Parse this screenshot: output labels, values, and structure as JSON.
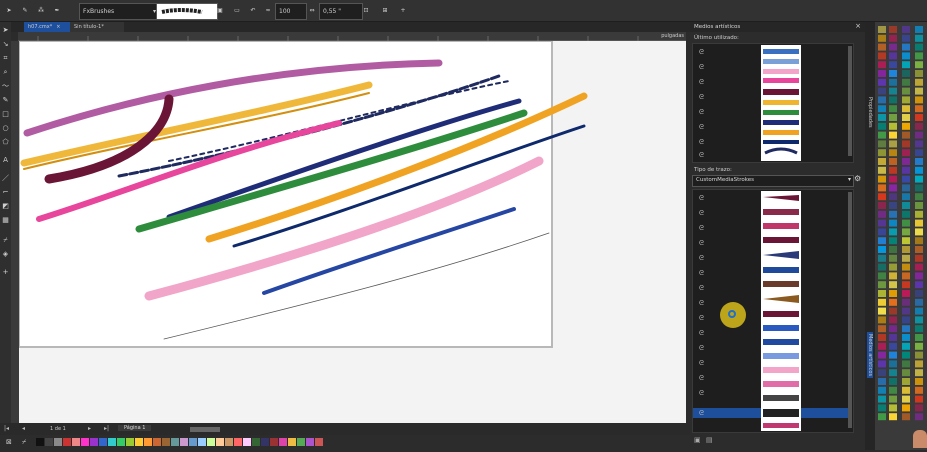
{
  "toolbar": {
    "brush_category": "FxBrushes",
    "smoothing": "100",
    "width": "0,55 \"",
    "icons": [
      "image-icon",
      "folder-icon",
      "undo-icon",
      "smoothing-icon",
      "width-icon",
      "square-icon",
      "grid-icon",
      "plus-icon"
    ]
  },
  "tabs": [
    {
      "label": "h07.cmx*"
    },
    {
      "label": "Sin título-1*"
    }
  ],
  "ruler": {
    "unit": "pulgadas"
  },
  "docker": {
    "title": "Medios artísticos",
    "recent_label": "Último utilizado:",
    "stroke_type_label": "Tipo de trazo:",
    "stroke_type_value": "CustomMediaStrokes"
  },
  "side_tabs": [
    "Propiedades",
    "Medios artísticos"
  ],
  "status": {
    "page_counter": "1 de 1",
    "page_tab": "Página 1"
  },
  "colors": {
    "accent": "#1e4f9c",
    "selected_row": "#1e4f9c",
    "canvas": "#f3f3f3",
    "cursor_ring": "#f2d21b"
  }
}
